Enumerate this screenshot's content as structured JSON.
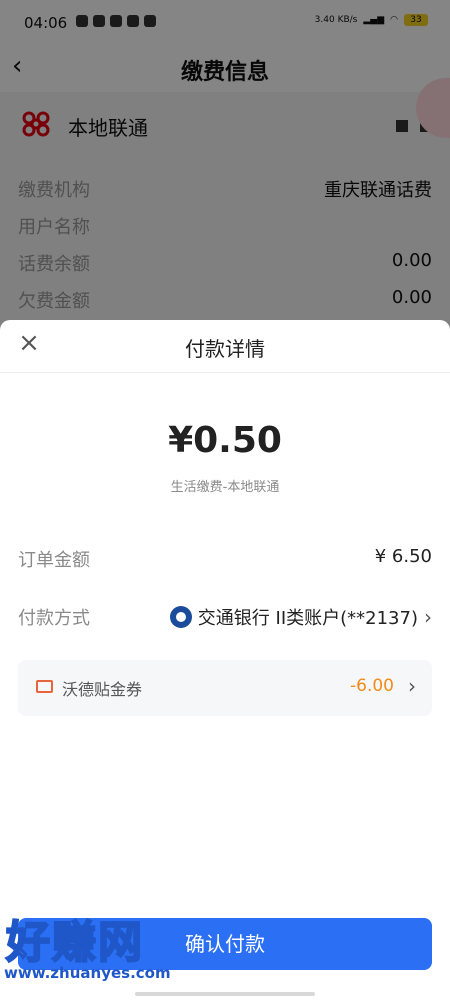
{
  "status_bar": {
    "time": "04:06",
    "net_speed": "3.40 KB/s",
    "battery": "33"
  },
  "background": {
    "nav": {
      "title": "缴费信息"
    },
    "operator": {
      "name": "本地联通"
    },
    "rows": [
      {
        "label": "缴费机构",
        "value": "重庆联通话费"
      },
      {
        "label": "用户名称",
        "value": ""
      },
      {
        "label": "话费余额",
        "value": "0.00"
      },
      {
        "label": "欠费金额",
        "value": "0.00"
      }
    ]
  },
  "sheet": {
    "title": "付款详情",
    "amount": "¥0.50",
    "description": "生活缴费-本地联通",
    "order": {
      "label": "订单金额",
      "value": "¥ 6.50"
    },
    "payment": {
      "label": "付款方式",
      "value": "交通银行 II类账户(**2137)"
    },
    "coupon": {
      "label": "沃德贴金券",
      "value": "-6.00"
    },
    "confirm_label": "确认付款"
  },
  "watermark": {
    "text": "好赚网",
    "url": "www.zhuanyes.com"
  },
  "colors": {
    "primary": "#2b6ff4",
    "coupon_accent": "#f28a1a",
    "bank": "#1b4c9c",
    "unicom_red": "#e60012"
  }
}
